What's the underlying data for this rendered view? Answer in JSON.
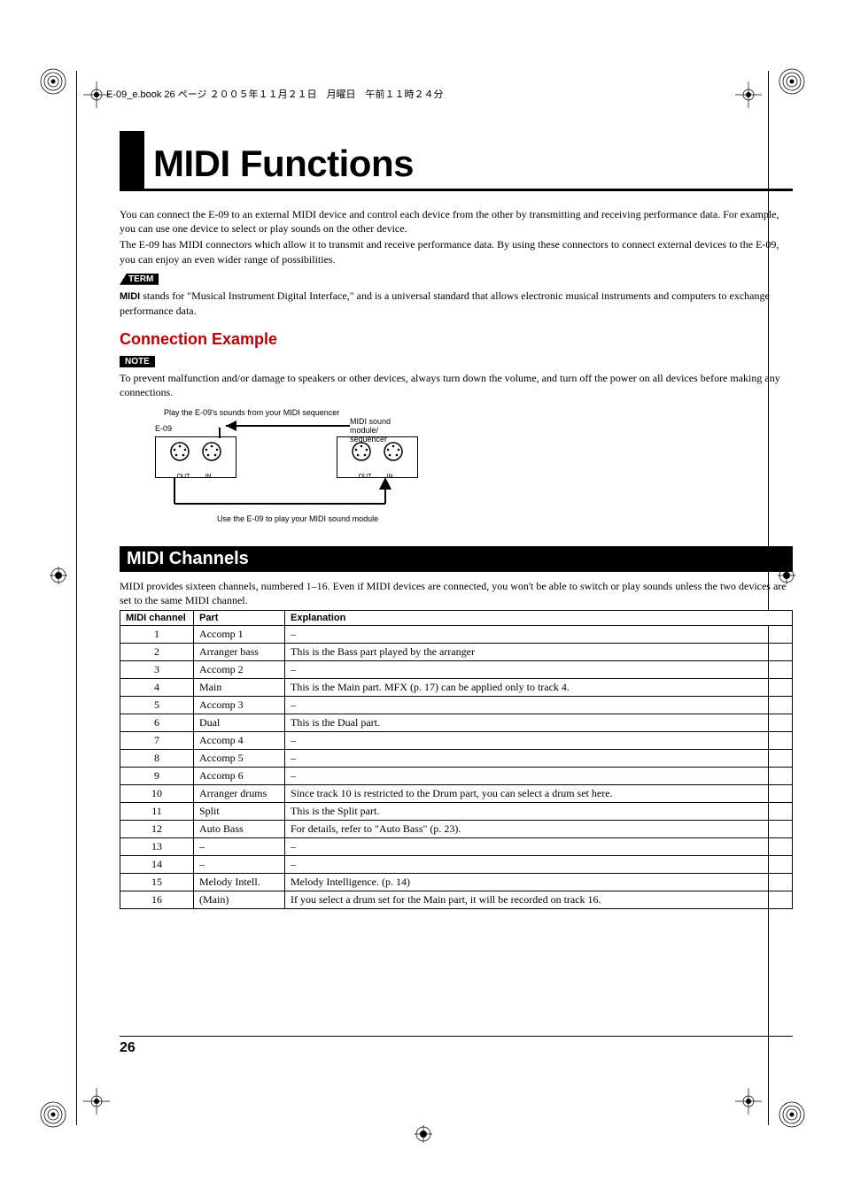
{
  "header": "E-09_e.book  26 ページ  ２００５年１１月２１日　月曜日　午前１１時２４分",
  "title": "MIDI Functions",
  "intro1": "You can connect the E-09 to an external MIDI device and control each device from the other by transmitting and receiving performance data. For example, you can use one device to select or play sounds on the other device.",
  "intro2": "The E-09 has MIDI connectors which allow it to transmit and receive performance data. By using these connectors to connect external devices to the E-09, you can enjoy an even wider range of possibilities.",
  "term_label": "TERM",
  "term_bold": "MIDI",
  "term_text": " stands for \"Musical Instrument Digital Interface,\" and is a universal standard that allows electronic musical instruments and computers to exchange performance data.",
  "h2_connection": "Connection Example",
  "note_label": "NOTE",
  "note_text": "To prevent malfunction and/or damage to speakers or other devices, always turn down the volume, and turn off the power on all devices before making any connections.",
  "diagram": {
    "top_label": "Play the E-09's sounds from your MIDI sequencer",
    "left_device": "E-09",
    "right_device": "MIDI sound module/\nsequencer",
    "bottom_label": "Use the E-09 to play your MIDI sound module",
    "out": "OUT",
    "in": "IN"
  },
  "section_midi_channels": "MIDI Channels",
  "channels_intro": "MIDI provides sixteen channels, numbered 1–16. Even if MIDI devices are connected, you won't be able to switch or play sounds unless the two devices are set to the same MIDI channel.",
  "table": {
    "headers": [
      "MIDI channel",
      "Part",
      "Explanation"
    ],
    "rows": [
      {
        "ch": "1",
        "part": "Accomp 1",
        "exp": "–"
      },
      {
        "ch": "2",
        "part": "Arranger bass",
        "exp": "This is the Bass part played by the arranger"
      },
      {
        "ch": "3",
        "part": "Accomp 2",
        "exp": "–"
      },
      {
        "ch": "4",
        "part": "Main",
        "exp": "This is the Main part. MFX (p. 17) can be applied only to track 4."
      },
      {
        "ch": "5",
        "part": "Accomp 3",
        "exp": "–"
      },
      {
        "ch": "6",
        "part": "Dual",
        "exp": "This is the Dual part."
      },
      {
        "ch": "7",
        "part": "Accomp 4",
        "exp": "–"
      },
      {
        "ch": "8",
        "part": "Accomp 5",
        "exp": "–"
      },
      {
        "ch": "9",
        "part": "Accomp 6",
        "exp": "–"
      },
      {
        "ch": "10",
        "part": "Arranger drums",
        "exp": "Since track 10 is restricted to the Drum part, you can select a drum set here."
      },
      {
        "ch": "11",
        "part": "Split",
        "exp": "This is the Split part."
      },
      {
        "ch": "12",
        "part": "Auto Bass",
        "exp": "For details, refer to \"Auto Bass\" (p. 23)."
      },
      {
        "ch": "13",
        "part": "–",
        "exp": "–"
      },
      {
        "ch": "14",
        "part": "–",
        "exp": "–"
      },
      {
        "ch": "15",
        "part": "Melody Intell.",
        "exp": "Melody Intelligence. (p. 14)"
      },
      {
        "ch": "16",
        "part": "(Main)",
        "exp": "If you select a drum set for the Main part, it will be recorded on track 16."
      }
    ]
  },
  "page_number": "26"
}
